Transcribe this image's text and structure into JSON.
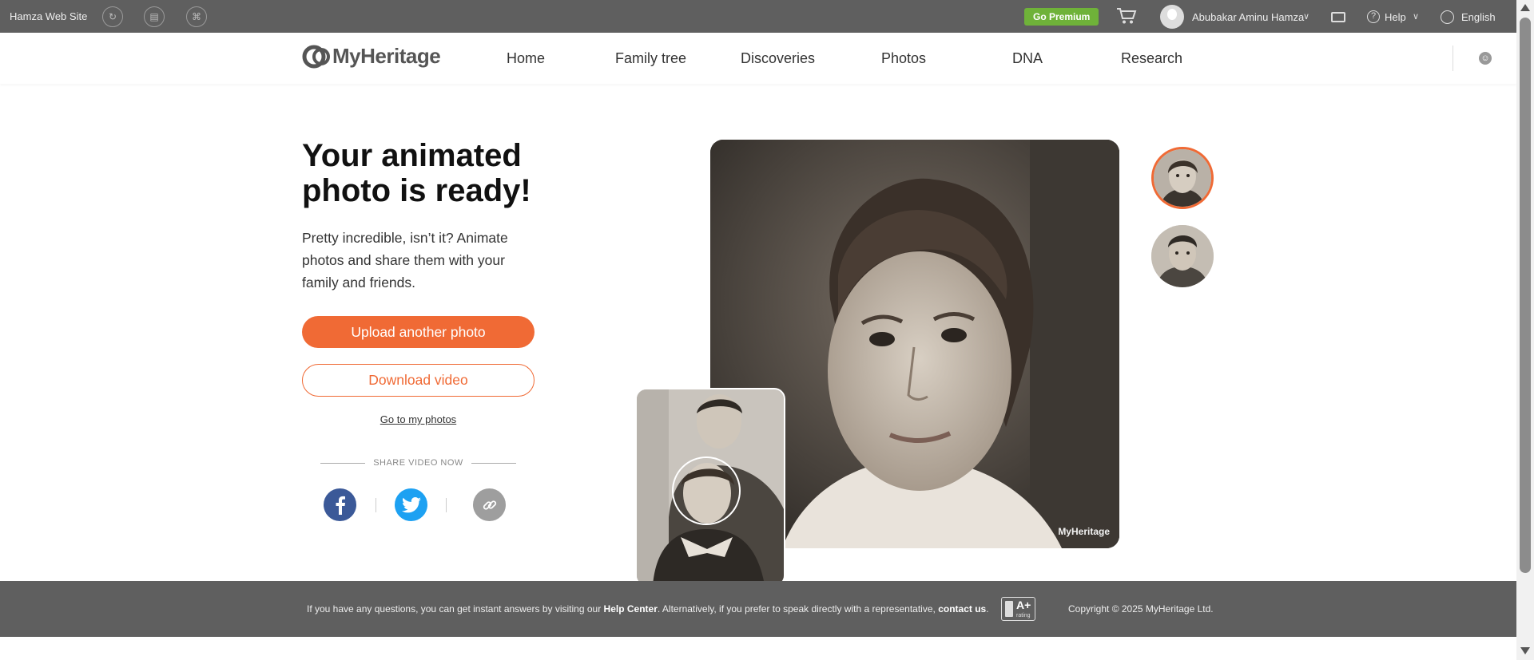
{
  "topbar": {
    "site_name": "Hamza Web Site",
    "premium_label": "Go Premium",
    "user_name": "Abubakar Aminu Hamza",
    "help_label": "Help",
    "language": "English"
  },
  "nav": {
    "logo_text": "MyHeritage",
    "items": [
      "Home",
      "Family tree",
      "Discoveries",
      "Photos",
      "DNA",
      "Research"
    ]
  },
  "hero": {
    "title": "Your animated photo is ready!",
    "subtitle": "Pretty incredible, isn’t it? Animate photos and share them with your family and friends.",
    "upload_label": "Upload another photo",
    "download_label": "Download video",
    "goto_label": "Go to my photos",
    "share_label": "SHARE VIDEO NOW"
  },
  "photo": {
    "watermark": "MyHeritage"
  },
  "footer": {
    "text_a": "If you have any questions, you can get instant answers by visiting our ",
    "help_center": "Help Center",
    "text_b": ". Alternatively, if you prefer to speak directly with a representative, ",
    "contact": "contact us",
    "text_c": ".",
    "bbb_rating": "A+",
    "bbb_sub": "rating",
    "copyright": "Copyright © 2025 MyHeritage Ltd."
  },
  "colors": {
    "accent": "#f06a35",
    "premium": "#6fb239",
    "bar": "#5f5f5f",
    "facebook": "#3b5998",
    "twitter": "#1da1f2",
    "link": "#9e9e9e"
  }
}
